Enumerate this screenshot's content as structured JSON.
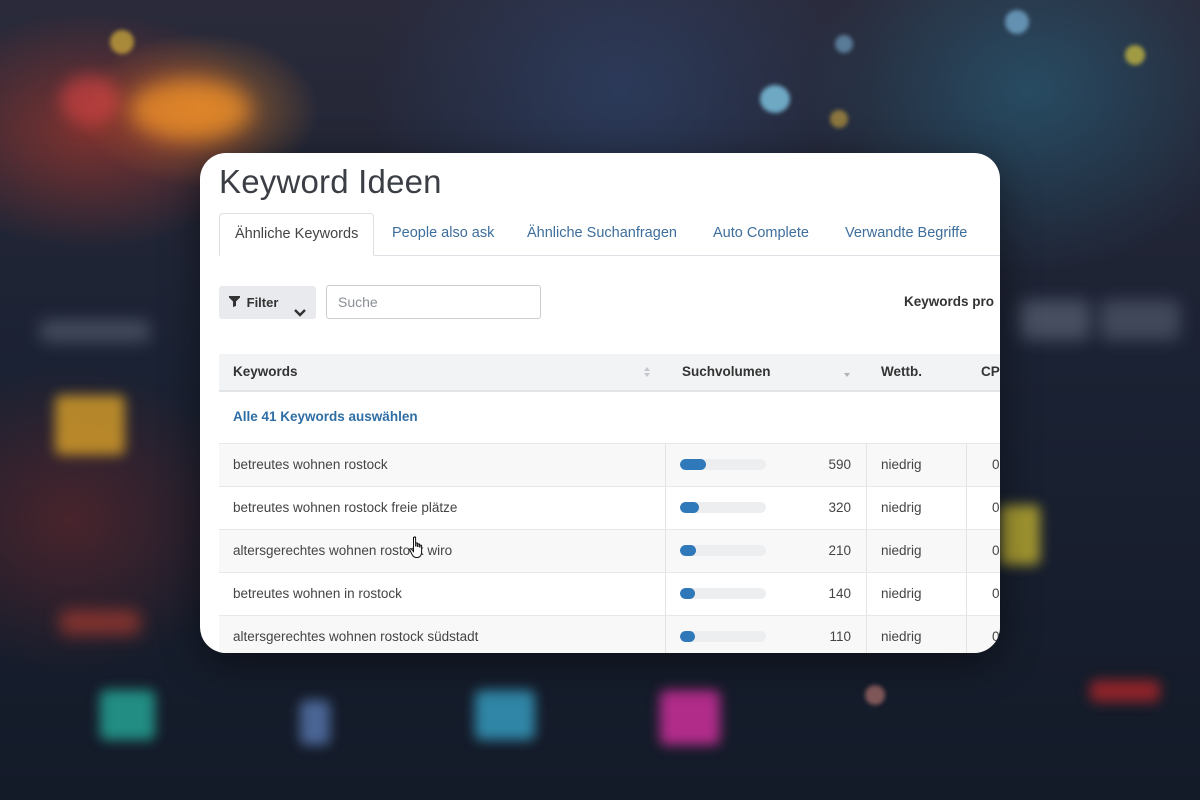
{
  "title": "Keyword Ideen",
  "tabs": [
    {
      "label": "Ähnliche Keywords",
      "active": true
    },
    {
      "label": "People also ask",
      "active": false
    },
    {
      "label": "Ähnliche Suchanfragen",
      "active": false
    },
    {
      "label": "Auto Complete",
      "active": false
    },
    {
      "label": "Verwandte Begriffe",
      "active": false
    }
  ],
  "toolbar": {
    "filter_label": "Filter",
    "search_placeholder": "Suche",
    "keywords_pro_label": "Keywords pro"
  },
  "table": {
    "headers": {
      "keywords": "Keywords",
      "volume": "Suchvolumen",
      "competition": "Wettb.",
      "cpc": "CP"
    },
    "select_all": "Alle 41 Keywords auswählen",
    "rows": [
      {
        "keyword": "betreutes wohnen rostock",
        "volume": "590",
        "volume_fraction": 0.3,
        "competition": "niedrig",
        "cpc": "0"
      },
      {
        "keyword": "betreutes wohnen rostock freie plätze",
        "volume": "320",
        "volume_fraction": 0.22,
        "competition": "niedrig",
        "cpc": "0"
      },
      {
        "keyword": "altersgerechtes wohnen rostock wiro",
        "volume": "210",
        "volume_fraction": 0.19,
        "competition": "niedrig",
        "cpc": "0"
      },
      {
        "keyword": "betreutes wohnen in rostock",
        "volume": "140",
        "volume_fraction": 0.17,
        "competition": "niedrig",
        "cpc": "0"
      },
      {
        "keyword": "altersgerechtes wohnen rostock südstadt",
        "volume": "110",
        "volume_fraction": 0.17,
        "competition": "niedrig",
        "cpc": "0"
      }
    ]
  },
  "colors": {
    "accent": "#2f78b9",
    "link": "#2f6ea5",
    "tab_link": "#3d6e9c"
  }
}
